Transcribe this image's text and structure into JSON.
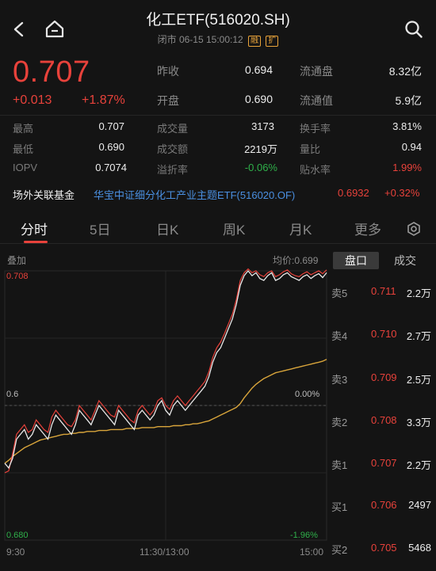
{
  "header": {
    "title": "化工ETF(516020.SH)",
    "subtitle": "闭市 06-15 15:00:12",
    "tag_margin": "融",
    "tag_expand": "扩"
  },
  "quote": {
    "price": "0.707",
    "change": "+0.013",
    "change_pct": "+1.87%",
    "rows": [
      {
        "l1": "昨收",
        "v1": "0.694",
        "l2": "流通盘",
        "v2": "8.32亿"
      },
      {
        "l1": "开盘",
        "v1": "0.690",
        "l2": "流通值",
        "v2": "5.9亿"
      }
    ]
  },
  "stats": {
    "rows": [
      {
        "a": "最高",
        "av": "0.707",
        "b": "成交量",
        "bv": "3173",
        "c": "换手率",
        "cv": "3.81%"
      },
      {
        "a": "最低",
        "av": "0.690",
        "b": "成交额",
        "bv": "2219万",
        "c": "量比",
        "cv": "0.94"
      },
      {
        "a": "IOPV",
        "av": "0.7074",
        "b": "溢折率",
        "bv": "-0.06%",
        "c": "贴水率",
        "cv": "1.99%"
      }
    ]
  },
  "fund": {
    "label": "场外关联基金",
    "name": "华宝中证细分化工产业主题ETF(516020.OF)",
    "price": "0.6932",
    "pct": "+0.32%"
  },
  "tabs": [
    "分时",
    "5日",
    "日K",
    "周K",
    "月K",
    "更多"
  ],
  "chart": {
    "overlay_label": "叠加",
    "avg_label": "均价:0.699",
    "y_top": "0.708",
    "y_bottom": "0.680",
    "y_mid": "0.6",
    "pct_mid": "0.00%",
    "pct_bottom": "-1.96%",
    "x_labels": [
      "9:30",
      "11:30/13:00",
      "15:00"
    ],
    "price_line": [
      0.688,
      0.6875,
      0.6885,
      0.6905,
      0.691,
      0.6915,
      0.6905,
      0.691,
      0.692,
      0.6915,
      0.691,
      0.6905,
      0.692,
      0.693,
      0.6925,
      0.692,
      0.6915,
      0.691,
      0.692,
      0.6935,
      0.693,
      0.6925,
      0.692,
      0.693,
      0.694,
      0.6935,
      0.693,
      0.6925,
      0.692,
      0.6935,
      0.693,
      0.6925,
      0.692,
      0.6915,
      0.693,
      0.6935,
      0.693,
      0.6925,
      0.693,
      0.694,
      0.6945,
      0.6935,
      0.693,
      0.694,
      0.6945,
      0.694,
      0.6935,
      0.694,
      0.6945,
      0.695,
      0.6955,
      0.696,
      0.697,
      0.6985,
      0.6995,
      0.7,
      0.701,
      0.702,
      0.703,
      0.7045,
      0.7065,
      0.7075,
      0.708,
      0.7075,
      0.7078,
      0.7072,
      0.707,
      0.7075,
      0.7078,
      0.707,
      0.7072,
      0.7076,
      0.7078,
      0.7074,
      0.7072,
      0.707,
      0.7074,
      0.7076,
      0.7072,
      0.7075,
      0.7077,
      0.7073,
      0.7078
    ],
    "iopv_line": [
      0.687,
      0.6872,
      0.689,
      0.691,
      0.6915,
      0.692,
      0.6912,
      0.6915,
      0.6925,
      0.692,
      0.6915,
      0.6912,
      0.6928,
      0.6935,
      0.693,
      0.6925,
      0.692,
      0.6918,
      0.6925,
      0.694,
      0.6935,
      0.693,
      0.6925,
      0.6935,
      0.6945,
      0.694,
      0.6935,
      0.693,
      0.6928,
      0.694,
      0.6935,
      0.693,
      0.6925,
      0.6922,
      0.6935,
      0.694,
      0.6935,
      0.693,
      0.6935,
      0.6945,
      0.6948,
      0.694,
      0.6936,
      0.6945,
      0.695,
      0.6945,
      0.694,
      0.6945,
      0.695,
      0.6955,
      0.696,
      0.6965,
      0.6975,
      0.699,
      0.7,
      0.7006,
      0.7015,
      0.7025,
      0.7035,
      0.705,
      0.707,
      0.7078,
      0.7082,
      0.7078,
      0.708,
      0.7076,
      0.7074,
      0.7078,
      0.708,
      0.7074,
      0.7076,
      0.7079,
      0.7081,
      0.7077,
      0.7075,
      0.7074,
      0.7077,
      0.7079,
      0.7076,
      0.7078,
      0.708,
      0.7077,
      0.7081
    ],
    "avg_line": [
      0.688,
      0.6883,
      0.6887,
      0.689,
      0.6893,
      0.6896,
      0.6898,
      0.69,
      0.6902,
      0.6904,
      0.6905,
      0.6906,
      0.6907,
      0.6908,
      0.6909,
      0.691,
      0.691,
      0.6911,
      0.6911,
      0.6912,
      0.6912,
      0.6913,
      0.6913,
      0.6913,
      0.6914,
      0.6914,
      0.6914,
      0.6915,
      0.6915,
      0.6915,
      0.6915,
      0.6916,
      0.6916,
      0.6916,
      0.6916,
      0.6917,
      0.6917,
      0.6917,
      0.6917,
      0.6918,
      0.6918,
      0.6918,
      0.6918,
      0.6919,
      0.6919,
      0.6919,
      0.692,
      0.692,
      0.6921,
      0.6921,
      0.6922,
      0.6923,
      0.6924,
      0.6926,
      0.6928,
      0.693,
      0.6932,
      0.6934,
      0.6936,
      0.6938,
      0.6942,
      0.6948,
      0.6953,
      0.6958,
      0.6962,
      0.6965,
      0.6968,
      0.697,
      0.6972,
      0.6974,
      0.6975,
      0.6976,
      0.6977,
      0.6978,
      0.6979,
      0.698,
      0.6981,
      0.6982,
      0.6983,
      0.6984,
      0.6985,
      0.6986,
      0.6988
    ]
  },
  "book": {
    "tab_active": "盘口",
    "tab_other": "成交",
    "rows": [
      {
        "label": "卖5",
        "price": "0.711",
        "vol": "2.2万"
      },
      {
        "label": "卖4",
        "price": "0.710",
        "vol": "2.7万"
      },
      {
        "label": "卖3",
        "price": "0.709",
        "vol": "2.5万"
      },
      {
        "label": "卖2",
        "price": "0.708",
        "vol": "3.3万"
      },
      {
        "label": "卖1",
        "price": "0.707",
        "vol": "2.2万"
      },
      {
        "label": "买1",
        "price": "0.706",
        "vol": "2497"
      },
      {
        "label": "买2",
        "price": "0.705",
        "vol": "5468"
      }
    ]
  },
  "colors": {
    "up": "#e8423b",
    "down": "#2fb04a",
    "avg": "#d9a53b",
    "iopv": "#e8e8e8"
  }
}
